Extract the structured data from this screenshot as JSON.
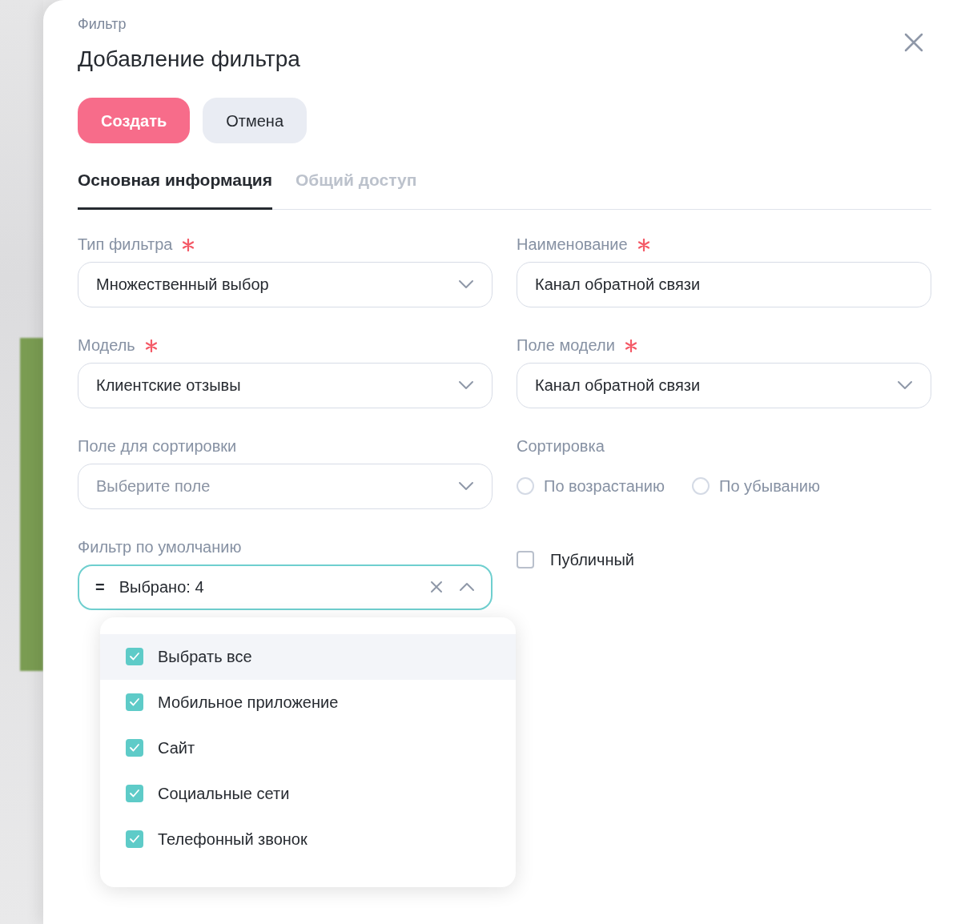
{
  "breadcrumb": "Фильтр",
  "title": "Добавление фильтра",
  "buttons": [
    {
      "label": "Создать",
      "kind": "primary"
    },
    {
      "label": "Отмена",
      "kind": "secondary"
    }
  ],
  "tabs": [
    {
      "label": "Основная информация",
      "selected": true
    },
    {
      "label": "Общий доступ",
      "selected": false
    }
  ],
  "fields": [
    {
      "kind": "select",
      "label": "Тип фильтра",
      "required": true,
      "value": "Множественный выбор"
    },
    {
      "kind": "input",
      "label": "Наименование",
      "required": true,
      "value": "Канал обратной связи"
    },
    {
      "kind": "select",
      "label": "Модель",
      "required": true,
      "value": "Клиентские отзывы"
    },
    {
      "kind": "select",
      "label": "Поле модели",
      "required": true,
      "value": "Канал обратной связи"
    },
    {
      "kind": "select",
      "label": "Поле для сортировки",
      "required": false,
      "placeholder": "Выберите поле"
    },
    {
      "kind": "radio_group",
      "label": "Сортировка",
      "required": false,
      "options": [
        {
          "label": "По возрастанию",
          "selected": false
        },
        {
          "label": "По убыванию",
          "selected": false
        }
      ]
    },
    {
      "kind": "multiselect",
      "label": "Фильтр по умолчанию",
      "required": false,
      "operator": "=",
      "value": "Выбрано: 4",
      "expanded": true,
      "options": [
        {
          "label": "Выбрать все",
          "checked": true,
          "highlighted": true
        },
        {
          "label": "Мобильное приложение",
          "checked": true,
          "highlighted": false
        },
        {
          "label": "Сайт",
          "checked": true,
          "highlighted": false
        },
        {
          "label": "Социальные сети",
          "checked": true,
          "highlighted": false
        },
        {
          "label": "Телефонный звонок",
          "checked": true,
          "highlighted": false
        }
      ]
    },
    {
      "kind": "checkbox",
      "label": "Публичный",
      "checked": false
    }
  ]
}
